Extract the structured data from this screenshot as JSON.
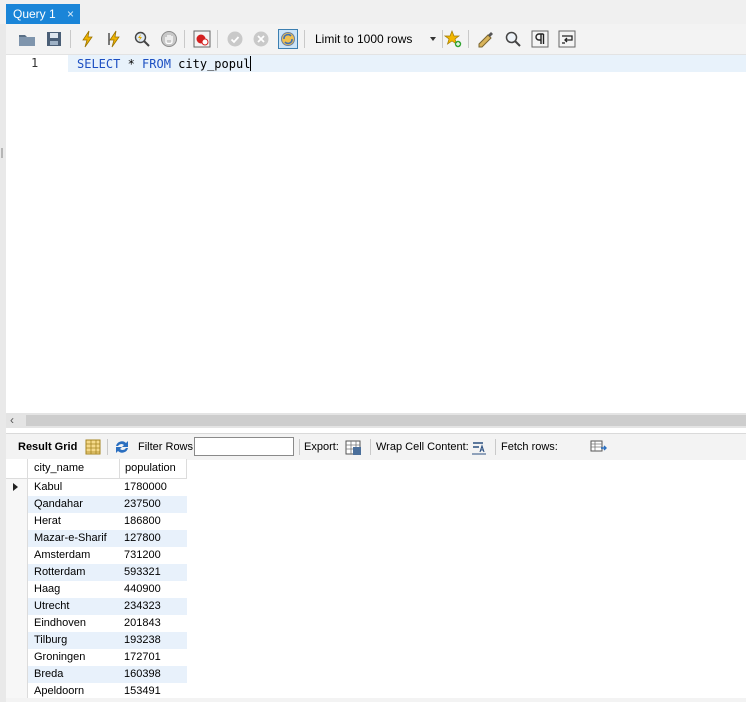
{
  "tab": {
    "label": "Query 1",
    "close": "×"
  },
  "toolbar": {
    "limit_value": "Limit to 1000 rows",
    "icons": [
      "open-folder-icon",
      "save-icon",
      "execute-icon",
      "execute-current-icon",
      "explain-icon",
      "stop-icon",
      "toggle-error-icon",
      "commit-icon",
      "rollback-icon",
      "autocommit-icon",
      "bookmark-add-icon",
      "beautify-icon",
      "find-icon",
      "invisible-chars-icon",
      "word-wrap-icon"
    ]
  },
  "editor": {
    "line_number": "1",
    "keyword1": "SELECT",
    "middle": " * ",
    "keyword2": "FROM",
    "rest": " city_popul"
  },
  "result_toolbar": {
    "result_grid_label": "Result Grid",
    "filter_rows_label": "Filter Rows:",
    "filter_value": "",
    "export_label": "Export:",
    "wrap_label": "Wrap Cell Content:",
    "fetch_label": "Fetch rows:"
  },
  "grid": {
    "columns": [
      "city_name",
      "population"
    ],
    "rows": [
      [
        "Kabul",
        "1780000"
      ],
      [
        "Qandahar",
        "237500"
      ],
      [
        "Herat",
        "186800"
      ],
      [
        "Mazar-e-Sharif",
        "127800"
      ],
      [
        "Amsterdam",
        "731200"
      ],
      [
        "Rotterdam",
        "593321"
      ],
      [
        "Haag",
        "440900"
      ],
      [
        "Utrecht",
        "234323"
      ],
      [
        "Eindhoven",
        "201843"
      ],
      [
        "Tilburg",
        "193238"
      ],
      [
        "Groningen",
        "172701"
      ],
      [
        "Breda",
        "160398"
      ],
      [
        "Apeldoorn",
        "153491"
      ]
    ]
  },
  "colors": {
    "accent": "#1a85d8",
    "keyword": "#1c4fc2",
    "row_alt": "#e8f1fb"
  }
}
